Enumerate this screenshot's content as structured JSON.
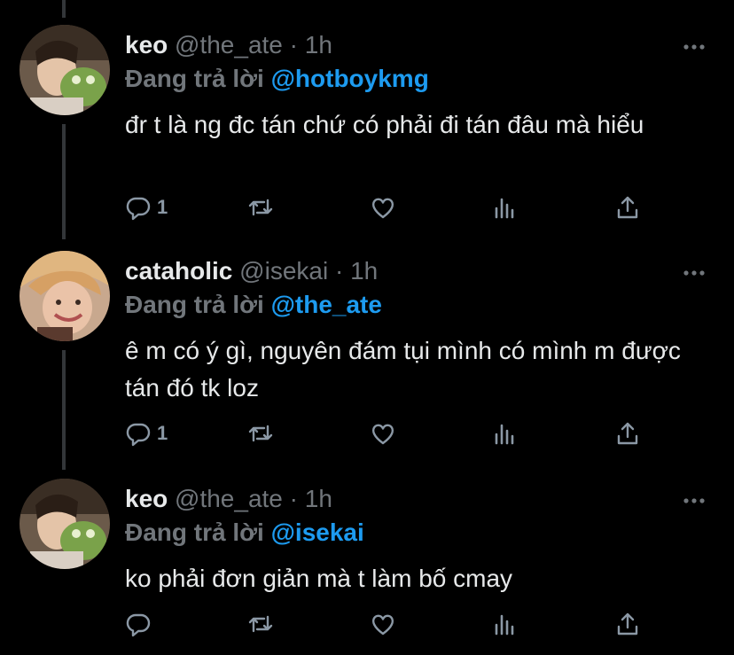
{
  "tweets": [
    {
      "name": "keo",
      "handle": "@the_ate",
      "dot": "·",
      "time": "1h",
      "replying_prefix": "Đang trả lời ",
      "replying_to": "@hotboykmg",
      "text": "đr t là ng đc tán chứ có phải đi tán đâu mà hiểu",
      "reply_count": "1"
    },
    {
      "name": "cataholic",
      "handle": "@isekai",
      "dot": "·",
      "time": "1h",
      "replying_prefix": "Đang trả lời ",
      "replying_to": "@the_ate",
      "text": "ê m có ý gì, nguyên đám tụi mình có mình m được tán đó tk loz",
      "reply_count": "1"
    },
    {
      "name": "keo",
      "handle": "@the_ate",
      "dot": "·",
      "time": "1h",
      "replying_prefix": "Đang trả lời ",
      "replying_to": "@isekai",
      "text": "ko phải đơn giản mà t làm bố cmay",
      "reply_count": ""
    }
  ],
  "icons": {
    "reply": "reply-icon",
    "retweet": "retweet-icon",
    "like": "heart-icon",
    "views": "views-icon",
    "share": "share-icon",
    "more": "more-icon"
  },
  "colors": {
    "background": "#000000",
    "text": "#e7e9ea",
    "muted": "#71767b",
    "mention": "#1d9bf0",
    "icon": "#8b98a5"
  }
}
